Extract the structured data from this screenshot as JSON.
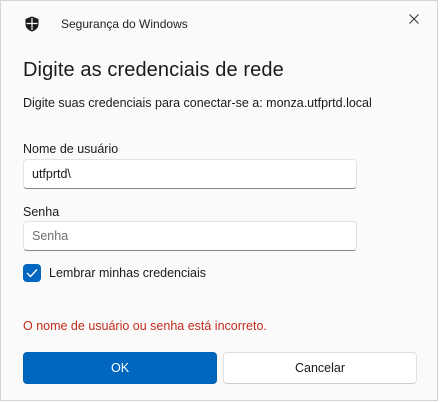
{
  "window": {
    "app_title": "Segurança do Windows",
    "close_icon": "close-icon",
    "app_icon": "shield-icon"
  },
  "dialog": {
    "heading": "Digite as credenciais de rede",
    "description": "Digite suas credenciais para conectar-se a: monza.utfprtd.local"
  },
  "form": {
    "username_label": "Nome de usuário",
    "username_value": "utfprtd\\",
    "password_label": "Senha",
    "password_value": "",
    "password_placeholder": "Senha",
    "remember_label": "Lembrar minhas credenciais",
    "remember_checked": true
  },
  "error_message": "O nome de usuário ou senha está incorreto.",
  "buttons": {
    "ok_label": "OK",
    "cancel_label": "Cancelar"
  },
  "colors": {
    "accent": "#0067c0",
    "error": "#c42b1c"
  }
}
